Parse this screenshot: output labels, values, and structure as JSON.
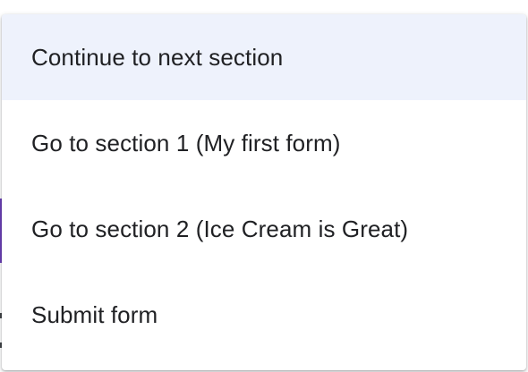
{
  "menu": {
    "items": [
      {
        "label": "Continue to next section",
        "selected": true
      },
      {
        "label": "Go to section 1 (My first form)",
        "selected": false
      },
      {
        "label": "Go to section 2 (Ice Cream is Great)",
        "selected": false
      },
      {
        "label": "Submit form",
        "selected": false
      }
    ]
  },
  "colors": {
    "selected_background": "#eef2fc",
    "text": "#202124",
    "form_accent": "#673ab7"
  }
}
